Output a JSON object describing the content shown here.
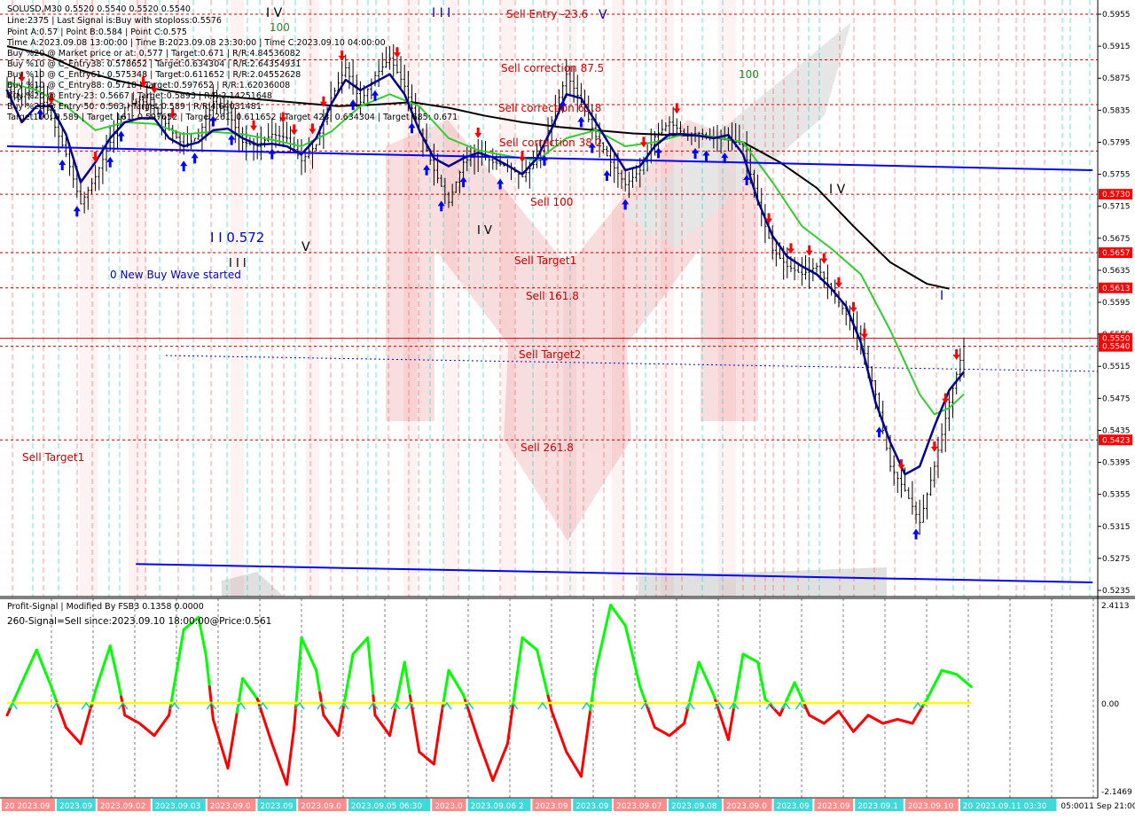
{
  "colors": {
    "background": "#ffffff",
    "grid": "#c0c0c0",
    "candle": "#000000",
    "ema_fast": "#00008b",
    "ema_mid": "#32cd32",
    "ema_slow": "#000000",
    "trend": "#0000ff",
    "buy_arrow": "#0000ff",
    "sell_arrow": "#ff0000",
    "level_line": "#c00000",
    "price_tag_bg": "#ff0000",
    "osc_up": "#00ff00",
    "osc_down": "#ff0000",
    "signal_line": "#ffff00",
    "watermark": "#f4cccc"
  },
  "header": {
    "lines": [
      "SOLUSD,M30  0.5520 0.5540 0.5520 0.5540",
      "Line:2375  | Last Signal is:Buy with stoploss:0.5576",
      "Point A:0.57  | Point B:0.584  | Point C:0.575",
      "Time A:2023.09.08 13:00:00  | Time B:2023.09.08 23:30:00  | Time C:2023.09.10 04:00:00",
      "Buy %20 @ Market price or at: 0.577  | Target:0.671  | R/R:4.84536082",
      "Buy %10 @ C_Entry38: 0.578652  | Target:0.634304  | R/R:2.64354931",
      "Buy %10 @ C_Entry61: 0.575348  | Target:0.611652  | R/R:2.04552628",
      "Buy %10 @ C_Entry88: 0.5718  | Target:0.597652  | R/R:1.62036008",
      "Buy %20 @ Entry-23: 0.5667  | Target:0.5893  | R/R:2.14251648",
      "Buy %20 @ Entry-50: 0.563  | Target:0.589  | R/R:4.64031481",
      "Target100: 0.589  | Target 161: 0.597652  | Target 261: 0.611652  | Target 423: 0.634304  | Target 685: 0.671"
    ]
  },
  "annotations": {
    "sell_entry": "Sell Entry -23.6",
    "sell_corr_875": "Sell correction 87.5",
    "sell_corr_618": "Sell correction 61.8",
    "sell_corr_382": "Sell correction 38.2",
    "sell_100": "Sell 100",
    "sell_target1_mid": "Sell Target1",
    "sell_1618": "Sell 161.8",
    "sell_target2": "Sell Target2",
    "sell_2618": "Sell  261.8",
    "sell_target1_left": "Sell Target1",
    "new_buy_wave": "0 New Buy Wave started",
    "wave_0572": "I I 0.572",
    "wave_III_a": "I I I",
    "wave_V_a": "V",
    "wave_IV_top": "I V",
    "wave_III_top": "I I I",
    "wave_V_top": "V",
    "wave_100": "100",
    "wave_100b": "100",
    "wave_IV_right": "I V",
    "wave_I_right": "I",
    "wave_IV_mid": "I V"
  },
  "price_axis": {
    "labels": [
      "0.5955",
      "0.5915",
      "0.5875",
      "0.5835",
      "0.5795",
      "0.5755",
      "0.5715",
      "0.5675",
      "0.5635",
      "0.5595",
      "0.5555",
      "0.5515",
      "0.5475",
      "0.5435",
      "0.5395",
      "0.5355",
      "0.5315",
      "0.5275",
      "0.5235"
    ],
    "tags": [
      {
        "text": "0.5730",
        "value": 0.573
      },
      {
        "text": "0.5657",
        "value": 0.5657
      },
      {
        "text": "0.5613",
        "value": 0.5613
      },
      {
        "text": "0.5550",
        "value": 0.555
      },
      {
        "text": "0.5540",
        "value": 0.554
      },
      {
        "text": "0.5423",
        "value": 0.5423
      }
    ]
  },
  "indicator": {
    "title": "Profit-Signal | Modified By FSB3 0.1358 0.0000",
    "signal_text": "260-Signal=Sell since:2023.09.10 18:00:00@Price:0.561",
    "axis_labels": [
      "2.4113",
      "0.00",
      "-2.1469"
    ]
  },
  "time_axis": {
    "labels": [
      "20 2023.09",
      "2023.09",
      "2023.09.02",
      "2023.09.03",
      "2023.09.0",
      "2023.09",
      "2023.09.0",
      "2023.09.05 06:30",
      "2023.0",
      "2023.09.06 2",
      "2023.09",
      "2023.09",
      "2023.09.07",
      "2023.09.08",
      "2023.09.0",
      "2023.09",
      "2023.09",
      "2023.09.1",
      "2023.09.10",
      "20 2023.09.11 03:30",
      "05:00",
      "11 Sep 21:00"
    ]
  },
  "chart_data": {
    "type": "candlestick",
    "symbol": "SOLUSD",
    "timeframe": "M30",
    "ylim": [
      0.5225,
      0.5975
    ],
    "levels": {
      "sell_entry": 0.5955,
      "sell_corr_875": 0.5898,
      "sell_corr_618": 0.5842,
      "sell_corr_382": 0.5784,
      "sell_100": 0.573,
      "sell_target1": 0.5657,
      "sell_1618": 0.5613,
      "sell_target2": 0.554,
      "sell_2618": 0.5423,
      "current_price_line": 0.555
    },
    "close_path": [
      [
        0,
        0.586
      ],
      [
        4,
        0.5852
      ],
      [
        8,
        0.5865
      ],
      [
        12,
        0.5825
      ],
      [
        16,
        0.578
      ],
      [
        20,
        0.5718
      ],
      [
        24,
        0.5752
      ],
      [
        28,
        0.5795
      ],
      [
        32,
        0.5838
      ],
      [
        36,
        0.5848
      ],
      [
        40,
        0.5838
      ],
      [
        44,
        0.5812
      ],
      [
        48,
        0.579
      ],
      [
        52,
        0.5803
      ],
      [
        56,
        0.5846
      ],
      [
        60,
        0.5832
      ],
      [
        64,
        0.5795
      ],
      [
        68,
        0.579
      ],
      [
        72,
        0.5805
      ],
      [
        76,
        0.58
      ],
      [
        80,
        0.5772
      ],
      [
        84,
        0.5792
      ],
      [
        88,
        0.585
      ],
      [
        92,
        0.5888
      ],
      [
        96,
        0.5845
      ],
      [
        100,
        0.5878
      ],
      [
        104,
        0.59
      ],
      [
        108,
        0.5865
      ],
      [
        112,
        0.581
      ],
      [
        116,
        0.576
      ],
      [
        120,
        0.572
      ],
      [
        124,
        0.577
      ],
      [
        128,
        0.5782
      ],
      [
        132,
        0.577
      ],
      [
        136,
        0.5765
      ],
      [
        140,
        0.5752
      ],
      [
        144,
        0.5772
      ],
      [
        148,
        0.5822
      ],
      [
        152,
        0.588
      ],
      [
        156,
        0.5845
      ],
      [
        160,
        0.5802
      ],
      [
        164,
        0.577
      ],
      [
        168,
        0.5742
      ],
      [
        172,
        0.576
      ],
      [
        176,
        0.5802
      ],
      [
        180,
        0.582
      ],
      [
        184,
        0.5805
      ],
      [
        188,
        0.5806
      ],
      [
        192,
        0.58
      ],
      [
        196,
        0.58
      ],
      [
        200,
        0.579
      ],
      [
        204,
        0.572
      ],
      [
        208,
        0.566
      ],
      [
        212,
        0.564
      ],
      [
        216,
        0.563
      ],
      [
        220,
        0.564
      ],
      [
        224,
        0.561
      ],
      [
        228,
        0.558
      ],
      [
        232,
        0.5548
      ],
      [
        236,
        0.548
      ],
      [
        240,
        0.539
      ],
      [
        244,
        0.536
      ],
      [
        248,
        0.532
      ],
      [
        252,
        0.539
      ],
      [
        256,
        0.547
      ],
      [
        260,
        0.554
      ]
    ],
    "ema_fast_path": [
      [
        0,
        0.586
      ],
      [
        4,
        0.582
      ],
      [
        8,
        0.584
      ],
      [
        12,
        0.584
      ],
      [
        16,
        0.5805
      ],
      [
        20,
        0.5745
      ],
      [
        24,
        0.577
      ],
      [
        28,
        0.58
      ],
      [
        32,
        0.582
      ],
      [
        36,
        0.5825
      ],
      [
        40,
        0.5825
      ],
      [
        44,
        0.58
      ],
      [
        48,
        0.579
      ],
      [
        52,
        0.5795
      ],
      [
        56,
        0.581
      ],
      [
        60,
        0.5812
      ],
      [
        64,
        0.58
      ],
      [
        68,
        0.5792
      ],
      [
        72,
        0.5793
      ],
      [
        76,
        0.579
      ],
      [
        80,
        0.578
      ],
      [
        84,
        0.58
      ],
      [
        88,
        0.5842
      ],
      [
        92,
        0.5873
      ],
      [
        96,
        0.586
      ],
      [
        100,
        0.587
      ],
      [
        104,
        0.588
      ],
      [
        108,
        0.5855
      ],
      [
        112,
        0.581
      ],
      [
        116,
        0.5775
      ],
      [
        120,
        0.5765
      ],
      [
        124,
        0.5775
      ],
      [
        128,
        0.5782
      ],
      [
        132,
        0.5776
      ],
      [
        136,
        0.5766
      ],
      [
        140,
        0.5755
      ],
      [
        144,
        0.5775
      ],
      [
        148,
        0.5812
      ],
      [
        152,
        0.5855
      ],
      [
        156,
        0.585
      ],
      [
        160,
        0.582
      ],
      [
        164,
        0.579
      ],
      [
        168,
        0.576
      ],
      [
        172,
        0.5765
      ],
      [
        176,
        0.579
      ],
      [
        180,
        0.5805
      ],
      [
        184,
        0.5805
      ],
      [
        188,
        0.5803
      ],
      [
        192,
        0.58
      ],
      [
        196,
        0.5804
      ],
      [
        200,
        0.578
      ],
      [
        204,
        0.5722
      ],
      [
        208,
        0.5678
      ],
      [
        212,
        0.5652
      ],
      [
        216,
        0.564
      ],
      [
        220,
        0.563
      ],
      [
        224,
        0.5612
      ],
      [
        228,
        0.559
      ],
      [
        232,
        0.5545
      ],
      [
        236,
        0.547
      ],
      [
        240,
        0.542
      ],
      [
        244,
        0.538
      ],
      [
        248,
        0.539
      ],
      [
        252,
        0.544
      ],
      [
        256,
        0.5485
      ],
      [
        260,
        0.5508
      ]
    ],
    "ema_mid_path": [
      [
        0,
        0.587
      ],
      [
        8,
        0.586
      ],
      [
        16,
        0.584
      ],
      [
        24,
        0.581
      ],
      [
        32,
        0.582
      ],
      [
        40,
        0.5818
      ],
      [
        48,
        0.5805
      ],
      [
        56,
        0.5808
      ],
      [
        64,
        0.5805
      ],
      [
        72,
        0.5798
      ],
      [
        80,
        0.579
      ],
      [
        88,
        0.5808
      ],
      [
        96,
        0.584
      ],
      [
        104,
        0.5855
      ],
      [
        112,
        0.584
      ],
      [
        120,
        0.58
      ],
      [
        128,
        0.5785
      ],
      [
        136,
        0.5778
      ],
      [
        144,
        0.5772
      ],
      [
        152,
        0.58
      ],
      [
        160,
        0.581
      ],
      [
        168,
        0.579
      ],
      [
        176,
        0.5795
      ],
      [
        184,
        0.5805
      ],
      [
        192,
        0.5802
      ],
      [
        200,
        0.5795
      ],
      [
        208,
        0.5745
      ],
      [
        216,
        0.569
      ],
      [
        224,
        0.5662
      ],
      [
        232,
        0.563
      ],
      [
        240,
        0.556
      ],
      [
        248,
        0.548
      ],
      [
        252,
        0.5455
      ],
      [
        256,
        0.5463
      ],
      [
        260,
        0.548
      ]
    ],
    "ema_slow_path": [
      [
        0,
        0.5915
      ],
      [
        10,
        0.5905
      ],
      [
        20,
        0.5885
      ],
      [
        30,
        0.5872
      ],
      [
        40,
        0.5862
      ],
      [
        50,
        0.5855
      ],
      [
        60,
        0.5852
      ],
      [
        70,
        0.5848
      ],
      [
        80,
        0.5844
      ],
      [
        90,
        0.584
      ],
      [
        100,
        0.5842
      ],
      [
        110,
        0.5845
      ],
      [
        120,
        0.5838
      ],
      [
        130,
        0.5828
      ],
      [
        140,
        0.582
      ],
      [
        150,
        0.5814
      ],
      [
        160,
        0.581
      ],
      [
        170,
        0.5806
      ],
      [
        180,
        0.5804
      ],
      [
        190,
        0.5803
      ],
      [
        200,
        0.5795
      ],
      [
        210,
        0.577
      ],
      [
        220,
        0.5738
      ],
      [
        230,
        0.569
      ],
      [
        240,
        0.5645
      ],
      [
        250,
        0.5618
      ],
      [
        256,
        0.5612
      ]
    ],
    "trend_lines": [
      {
        "from": [
          0,
          0.579
        ],
        "to": [
          295,
          0.576
        ]
      },
      {
        "from": [
          35,
          0.5268
        ],
        "to": [
          295,
          0.5245
        ]
      }
    ],
    "osc_path": [
      [
        0,
        -0.3
      ],
      [
        4,
        0.5
      ],
      [
        8,
        1.3
      ],
      [
        12,
        0.4
      ],
      [
        16,
        -0.6
      ],
      [
        20,
        -1.0
      ],
      [
        24,
        0.3
      ],
      [
        28,
        1.4
      ],
      [
        30,
        0.6
      ],
      [
        32,
        -0.3
      ],
      [
        36,
        -0.5
      ],
      [
        40,
        -0.8
      ],
      [
        44,
        -0.3
      ],
      [
        48,
        1.8
      ],
      [
        52,
        2.1
      ],
      [
        54,
        1.2
      ],
      [
        56,
        -0.4
      ],
      [
        60,
        -1.6
      ],
      [
        62,
        -0.5
      ],
      [
        64,
        0.6
      ],
      [
        68,
        0.1
      ],
      [
        72,
        -1.0
      ],
      [
        76,
        -2.0
      ],
      [
        78,
        -0.6
      ],
      [
        80,
        1.6
      ],
      [
        84,
        0.8
      ],
      [
        86,
        -0.3
      ],
      [
        90,
        -0.8
      ],
      [
        94,
        1.2
      ],
      [
        98,
        1.6
      ],
      [
        100,
        -0.3
      ],
      [
        104,
        -0.8
      ],
      [
        108,
        1.0
      ],
      [
        112,
        -1.2
      ],
      [
        116,
        -1.5
      ],
      [
        118,
        -0.3
      ],
      [
        120,
        0.8
      ],
      [
        124,
        0.2
      ],
      [
        128,
        -0.9
      ],
      [
        132,
        -1.9
      ],
      [
        136,
        -1.0
      ],
      [
        140,
        1.6
      ],
      [
        144,
        1.3
      ],
      [
        148,
        -0.2
      ],
      [
        152,
        -1.2
      ],
      [
        156,
        -1.8
      ],
      [
        160,
        0.8
      ],
      [
        164,
        2.4
      ],
      [
        168,
        1.9
      ],
      [
        172,
        0.4
      ],
      [
        176,
        -0.6
      ],
      [
        180,
        -0.8
      ],
      [
        184,
        -0.5
      ],
      [
        188,
        1.0
      ],
      [
        192,
        0.2
      ],
      [
        196,
        -0.9
      ],
      [
        200,
        1.2
      ],
      [
        204,
        1.0
      ],
      [
        206,
        0.1
      ],
      [
        210,
        -0.3
      ],
      [
        214,
        0.5
      ],
      [
        218,
        -0.3
      ],
      [
        222,
        -0.5
      ],
      [
        226,
        -0.2
      ],
      [
        230,
        -0.7
      ],
      [
        234,
        -0.3
      ],
      [
        238,
        -0.5
      ],
      [
        242,
        -0.4
      ],
      [
        246,
        -0.5
      ],
      [
        250,
        0.1
      ],
      [
        254,
        0.8
      ],
      [
        258,
        0.7
      ],
      [
        262,
        0.4
      ]
    ]
  }
}
